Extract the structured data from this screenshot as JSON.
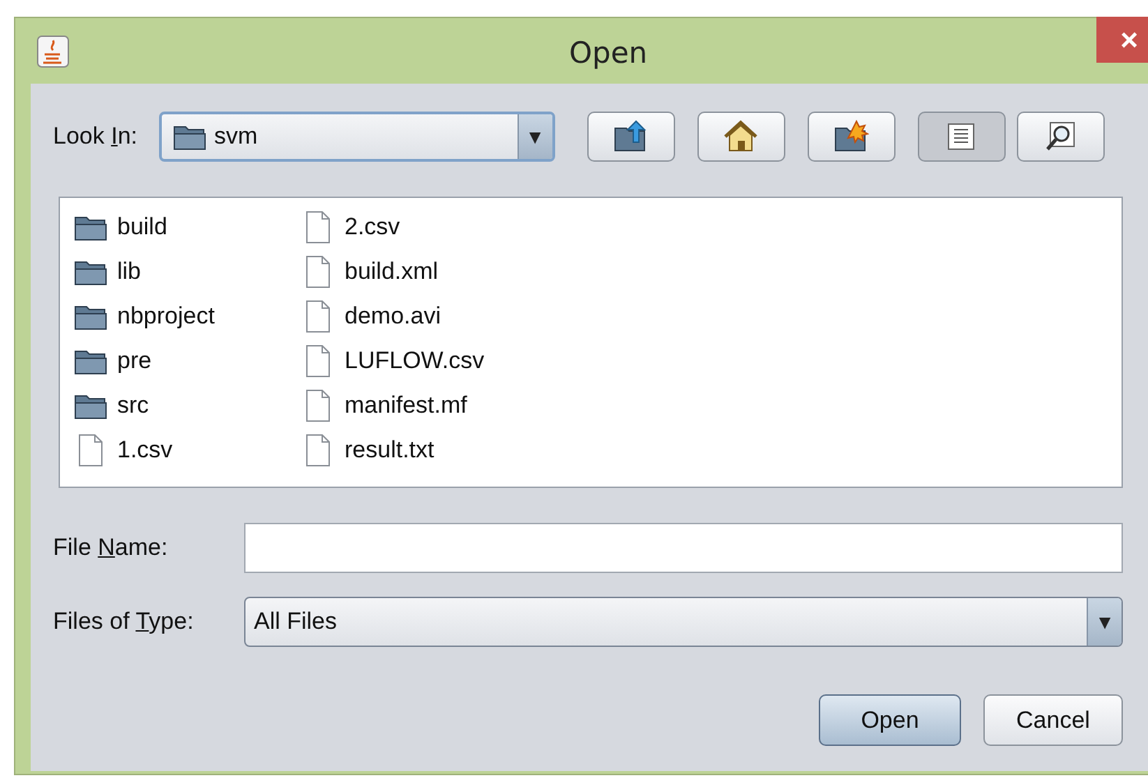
{
  "window": {
    "title": "Open",
    "close": "×"
  },
  "look_in": {
    "label": {
      "before": "Look ",
      "key": "I",
      "after": "n:"
    },
    "value": "svm"
  },
  "toolbar": [
    {
      "kind": "up"
    },
    {
      "kind": "home"
    },
    {
      "kind": "new_folder"
    },
    {
      "kind": "list",
      "selected": true
    },
    {
      "kind": "details",
      "selected": false
    }
  ],
  "files": [
    {
      "name": "build",
      "kind": "folder"
    },
    {
      "name": "lib",
      "kind": "folder"
    },
    {
      "name": "nbproject",
      "kind": "folder"
    },
    {
      "name": "pre",
      "kind": "folder"
    },
    {
      "name": "src",
      "kind": "folder"
    },
    {
      "name": "1.csv",
      "kind": "file"
    },
    {
      "name": "2.csv",
      "kind": "file"
    },
    {
      "name": "build.xml",
      "kind": "file"
    },
    {
      "name": "demo.avi",
      "kind": "file"
    },
    {
      "name": "LUFLOW.csv",
      "kind": "file"
    },
    {
      "name": "manifest.mf",
      "kind": "file"
    },
    {
      "name": "result.txt",
      "kind": "file"
    }
  ],
  "file_name": {
    "label": {
      "before": "File ",
      "key": "N",
      "after": "ame:"
    }
  },
  "files_of_type": {
    "label": {
      "before": "Files of ",
      "key": "T",
      "after": "ype:"
    },
    "value": "All Files",
    "arrow": "▼"
  },
  "buttons": [
    {
      "label": "Open",
      "kind": "default"
    },
    {
      "label": "Cancel",
      "kind": "normal"
    }
  ]
}
